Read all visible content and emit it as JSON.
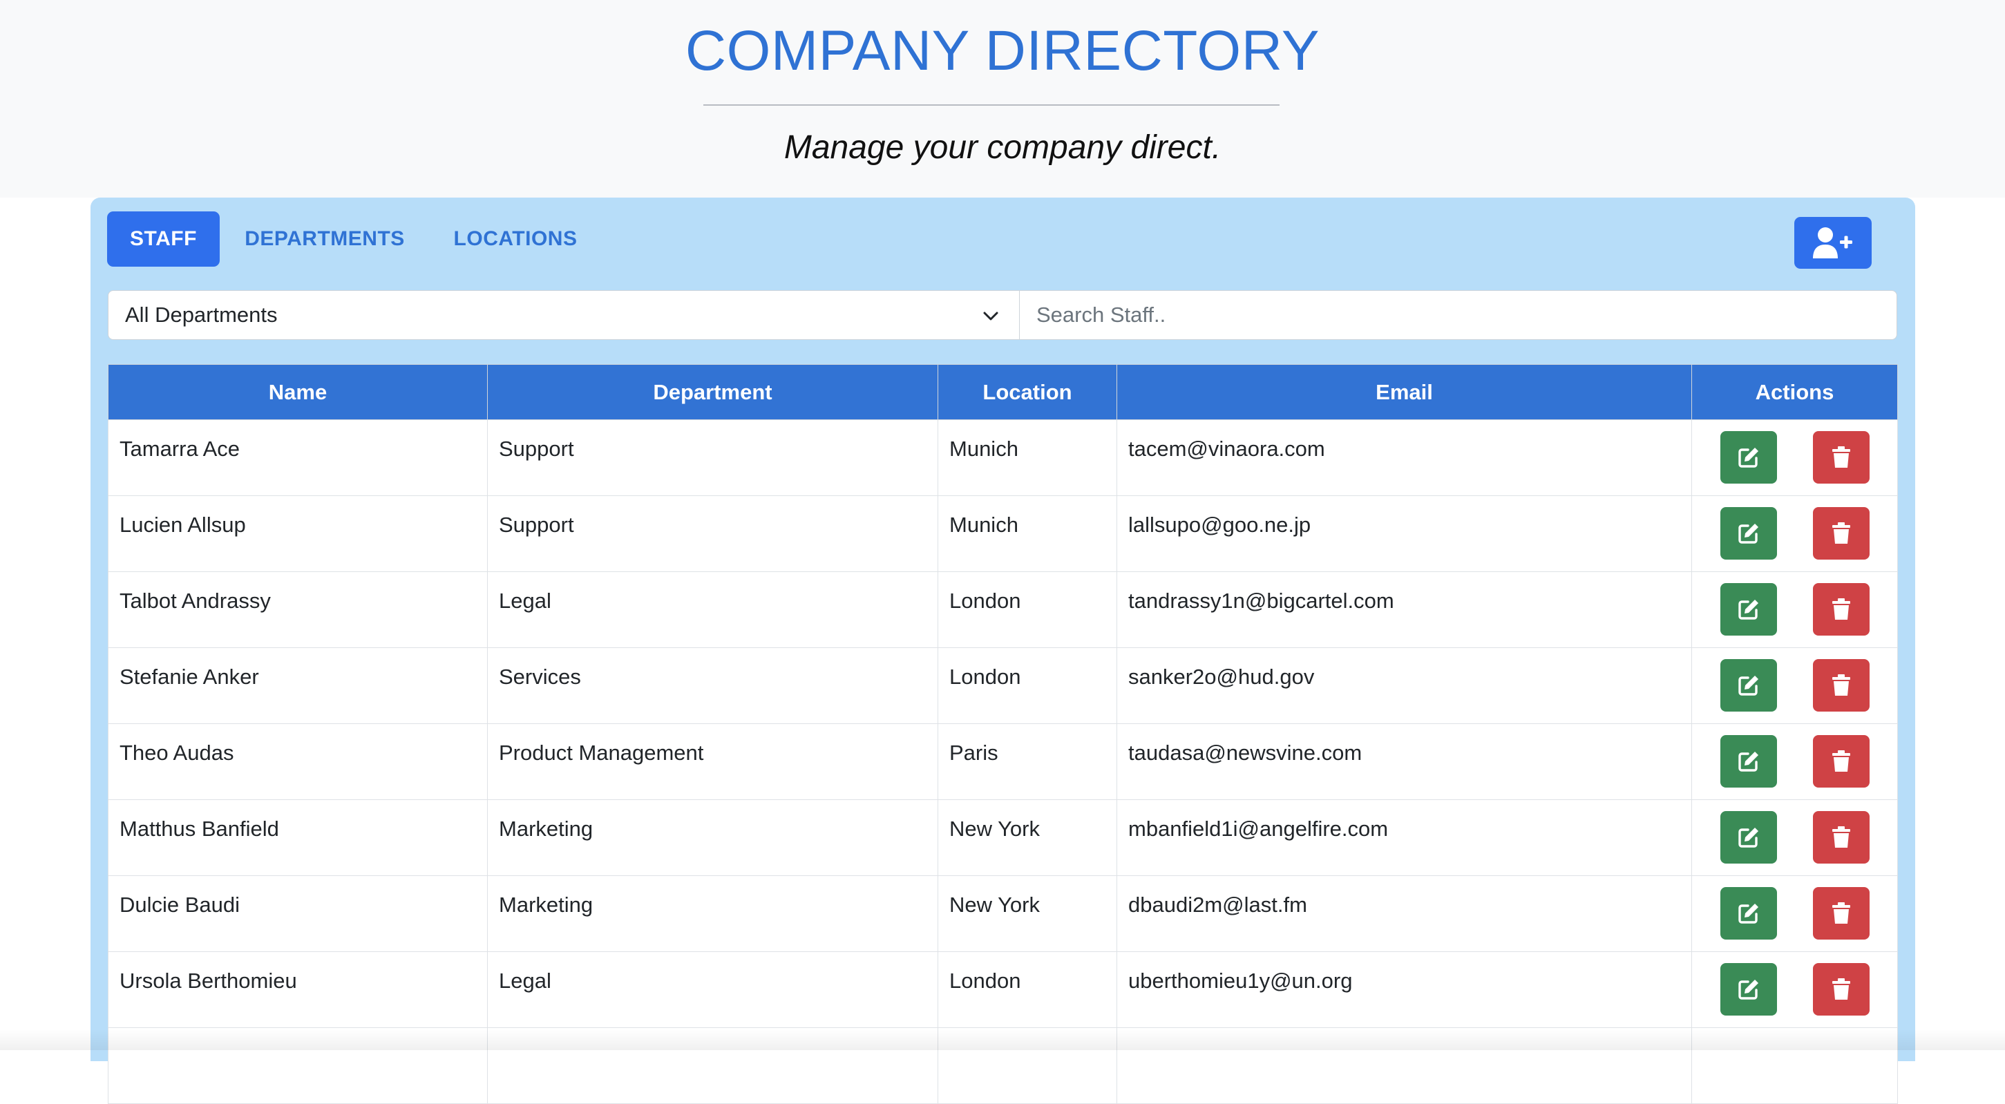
{
  "header": {
    "title": "COMPANY DIRECTORY",
    "subtitle": "Manage your company direct."
  },
  "tabs": [
    {
      "label": "STAFF",
      "active": true
    },
    {
      "label": "DEPARTMENTS",
      "active": false
    },
    {
      "label": "LOCATIONS",
      "active": false
    }
  ],
  "add_button_icon": "user-plus-icon",
  "filters": {
    "department_selected": "All Departments",
    "search_placeholder": "Search Staff.."
  },
  "table": {
    "headers": [
      "Name",
      "Department",
      "Location",
      "Email",
      "Actions"
    ],
    "rows": [
      {
        "name": "Tamarra Ace",
        "department": "Support",
        "location": "Munich",
        "email": "tacem@vinaora.com"
      },
      {
        "name": "Lucien Allsup",
        "department": "Support",
        "location": "Munich",
        "email": "lallsupo@goo.ne.jp"
      },
      {
        "name": "Talbot Andrassy",
        "department": "Legal",
        "location": "London",
        "email": "tandrassy1n@bigcartel.com"
      },
      {
        "name": "Stefanie Anker",
        "department": "Services",
        "location": "London",
        "email": "sanker2o@hud.gov"
      },
      {
        "name": "Theo Audas",
        "department": "Product Management",
        "location": "Paris",
        "email": "taudasa@newsvine.com"
      },
      {
        "name": "Matthus Banfield",
        "department": "Marketing",
        "location": "New York",
        "email": "mbanfield1i@angelfire.com"
      },
      {
        "name": "Dulcie Baudi",
        "department": "Marketing",
        "location": "New York",
        "email": "dbaudi2m@last.fm"
      },
      {
        "name": "Ursola Berthomieu",
        "department": "Legal",
        "location": "London",
        "email": "uberthomieu1y@un.org"
      }
    ]
  },
  "colors": {
    "accent": "#2f6fec",
    "title": "#2f72d4",
    "panel": "#b7ddf9",
    "edit": "#3a8b56",
    "delete": "#cf4245"
  }
}
